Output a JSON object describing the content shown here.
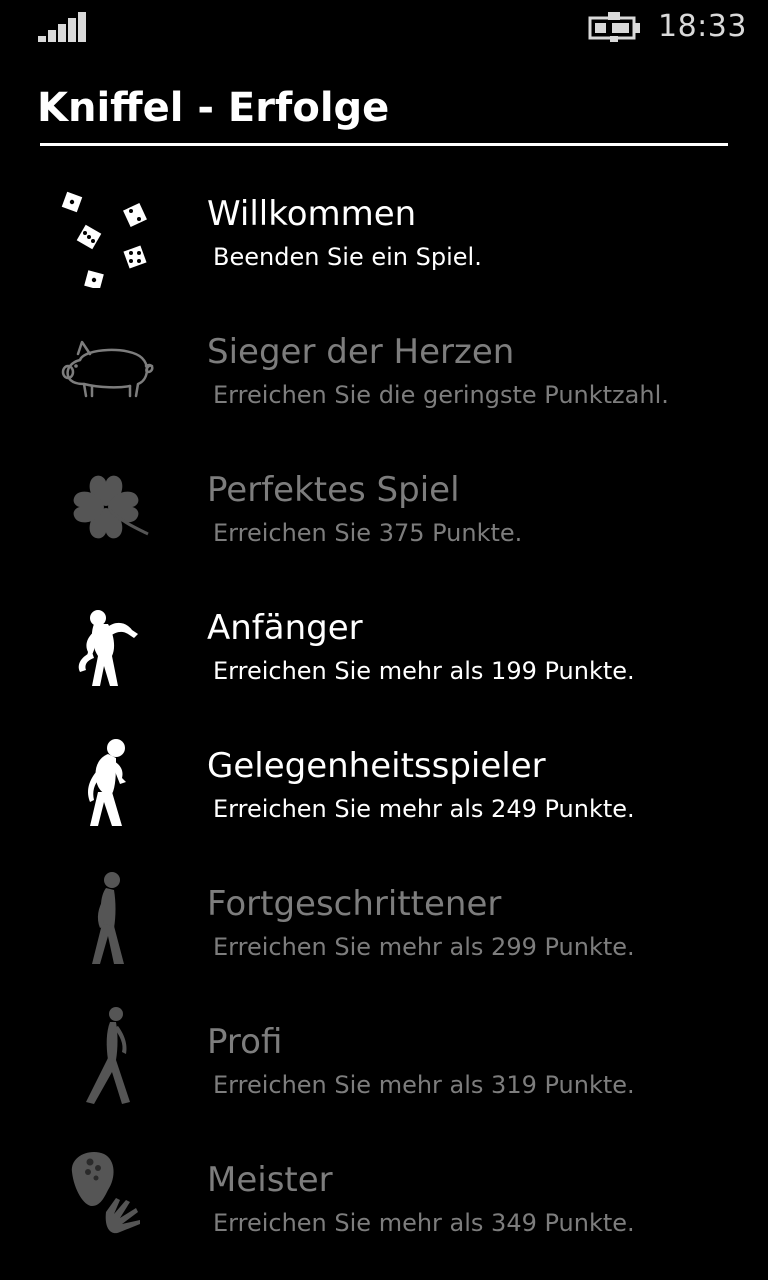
{
  "status_bar": {
    "time": "18:33",
    "signal_icon": "signal-strength-icon",
    "battery_icon": "battery-charging-icon"
  },
  "page": {
    "title": "Kniffel - Erfolge"
  },
  "colors": {
    "background": "#000000",
    "unlocked": "#ffffff",
    "locked": "#7d7d7d"
  },
  "achievements": [
    {
      "name": "Willkommen",
      "description": "Beenden Sie ein Spiel.",
      "unlocked": true,
      "icon": "dice-icon"
    },
    {
      "name": "Sieger der Herzen",
      "description": "Erreichen Sie die geringste Punktzahl.",
      "unlocked": false,
      "icon": "pig-icon"
    },
    {
      "name": "Perfektes Spiel",
      "description": "Erreichen Sie 375 Punkte.",
      "unlocked": false,
      "icon": "four-leaf-clover-icon"
    },
    {
      "name": "Anfänger",
      "description": "Erreichen Sie mehr als 199 Punkte.",
      "unlocked": true,
      "icon": "monkey-icon"
    },
    {
      "name": "Gelegenheitsspieler",
      "description": "Erreichen Sie mehr als 249 Punkte.",
      "unlocked": true,
      "icon": "ape-man-icon"
    },
    {
      "name": "Fortgeschrittener",
      "description": "Erreichen Sie mehr als 299 Punkte.",
      "unlocked": false,
      "icon": "early-human-icon"
    },
    {
      "name": "Profi",
      "description": "Erreichen Sie mehr als 319 Punkte.",
      "unlocked": false,
      "icon": "walking-human-icon"
    },
    {
      "name": "Meister",
      "description": "Erreichen Sie mehr als 349 Punkte.",
      "unlocked": false,
      "icon": "head-with-hand-icon"
    }
  ]
}
